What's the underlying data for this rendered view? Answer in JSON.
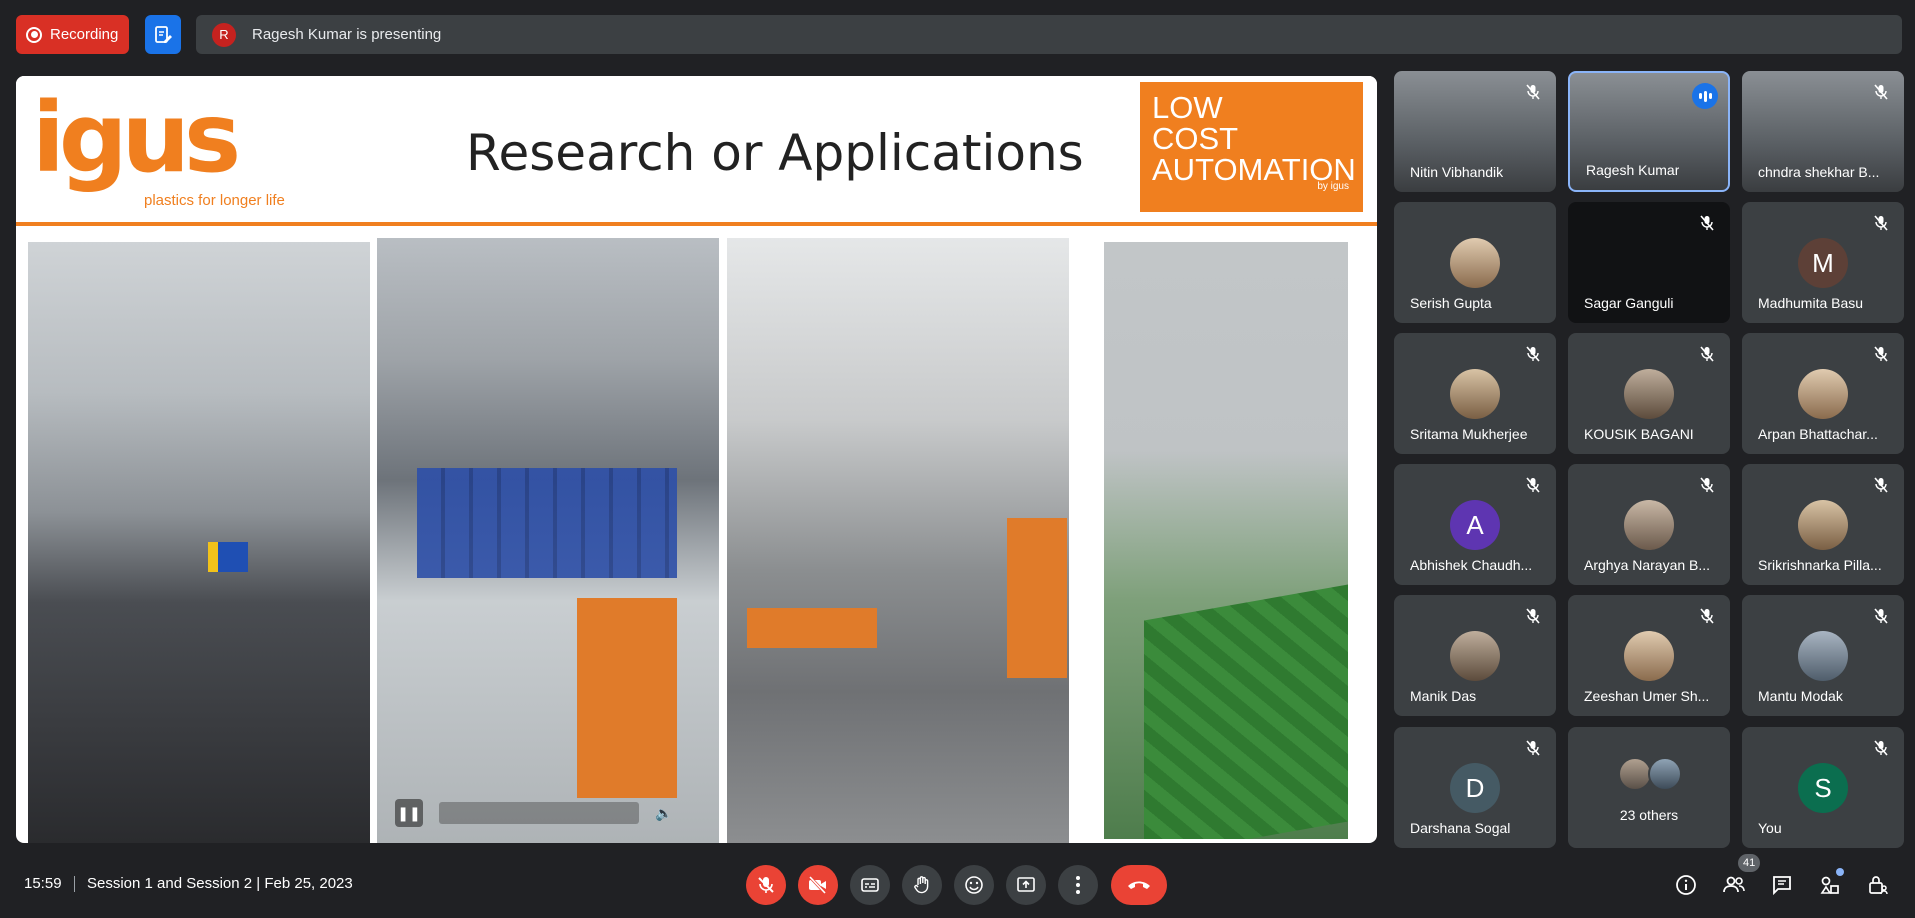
{
  "recording": {
    "label": "Recording"
  },
  "presenter": {
    "initial": "R",
    "text": "Ragesh Kumar is presenting"
  },
  "slide": {
    "brand": "igus",
    "brand_tagline": "plastics for longer life",
    "title": "Research or Applications",
    "badge_line1": "LOW",
    "badge_line2": "COST",
    "badge_line3": "AUTOMATION",
    "badge_by": "by igus"
  },
  "participants": [
    {
      "name": "Nitin Vibhandik",
      "type": "video",
      "muted": true
    },
    {
      "name": "Ragesh Kumar",
      "type": "video",
      "speaking": true
    },
    {
      "name": "chndra shekhar B...",
      "type": "video",
      "muted": true
    },
    {
      "name": "Serish Gupta",
      "type": "photo",
      "muted": false
    },
    {
      "name": "Sagar Ganguli",
      "type": "dark",
      "muted": true
    },
    {
      "name": "Madhumita Basu",
      "initial": "M",
      "color": "#5d4037",
      "muted": true
    },
    {
      "name": "Sritama Mukherjee",
      "type": "photo",
      "muted": true
    },
    {
      "name": "KOUSIK BAGANI",
      "type": "photo",
      "muted": true
    },
    {
      "name": "Arpan Bhattachar...",
      "type": "photo",
      "muted": true
    },
    {
      "name": "Abhishek Chaudh...",
      "initial": "A",
      "color": "#5e35b1",
      "muted": true
    },
    {
      "name": "Arghya Narayan B...",
      "type": "photo",
      "muted": true
    },
    {
      "name": "Srikrishnarka Pilla...",
      "type": "photo",
      "muted": true
    },
    {
      "name": "Manik Das",
      "type": "photo",
      "muted": true
    },
    {
      "name": "Zeeshan Umer Sh...",
      "type": "photo",
      "muted": true
    },
    {
      "name": "Mantu Modak",
      "type": "photo",
      "muted": true
    },
    {
      "name": "Darshana Sogal",
      "initial": "D",
      "color": "#455a64",
      "muted": true
    },
    {
      "name": "23 others",
      "type": "others"
    },
    {
      "name": "You",
      "initial": "S",
      "color": "#0b6e4f",
      "muted": true
    }
  ],
  "footer": {
    "time": "15:59",
    "meeting": "Session 1 and Session 2 | Feb 25, 2023",
    "people_count": "41"
  },
  "colors": {
    "accent": "#1a73e8",
    "danger": "#ea4335",
    "brand_orange": "#f07f1f"
  }
}
